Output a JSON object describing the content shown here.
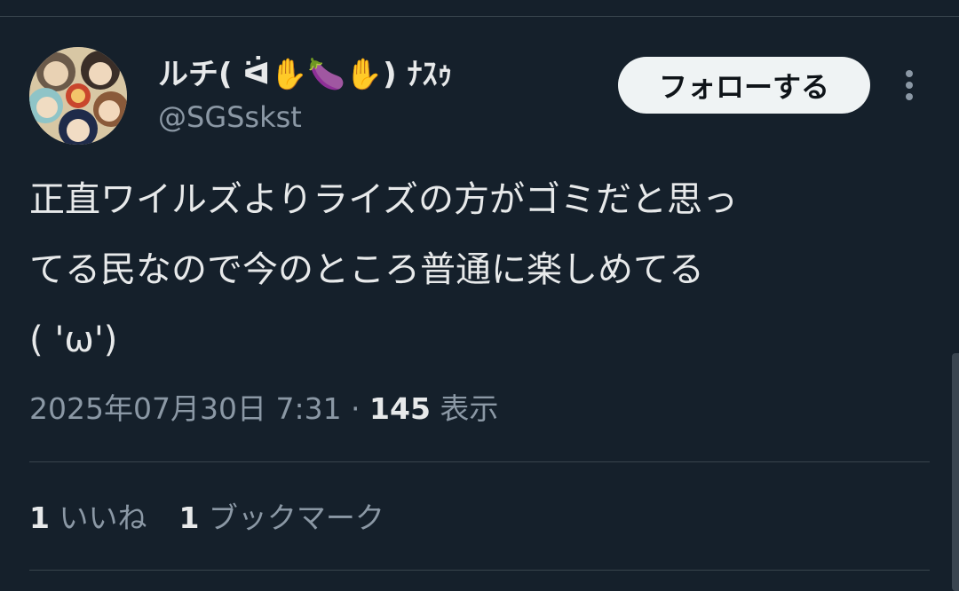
{
  "author": {
    "display_name": "ルチ( ᐛ✋🍆✋) ﾅｽｩ",
    "handle": "@SGSskst"
  },
  "follow_label": "フォローする",
  "tweet": {
    "lines": [
      "正直ワイルズよりライズの方がゴミだと思っ",
      "てる民なので今のところ普通に楽しめてる",
      "( 'ω')"
    ]
  },
  "meta": {
    "timestamp": "2025年07月30日 7:31",
    "separator": " · ",
    "views_count": "145",
    "views_label": " 表示"
  },
  "stats": {
    "likes_count": "1",
    "likes_label": " いいね",
    "bookmarks_count": "1",
    "bookmarks_label": " ブックマーク"
  },
  "colors": {
    "background": "#15202b",
    "text_primary": "#e7e9ea",
    "text_secondary": "#8b98a5",
    "divider": "#38444d",
    "follow_button_bg": "#eff3f4"
  },
  "icons": {
    "more": "more-vertical-icon",
    "avatar": "profile-avatar"
  }
}
